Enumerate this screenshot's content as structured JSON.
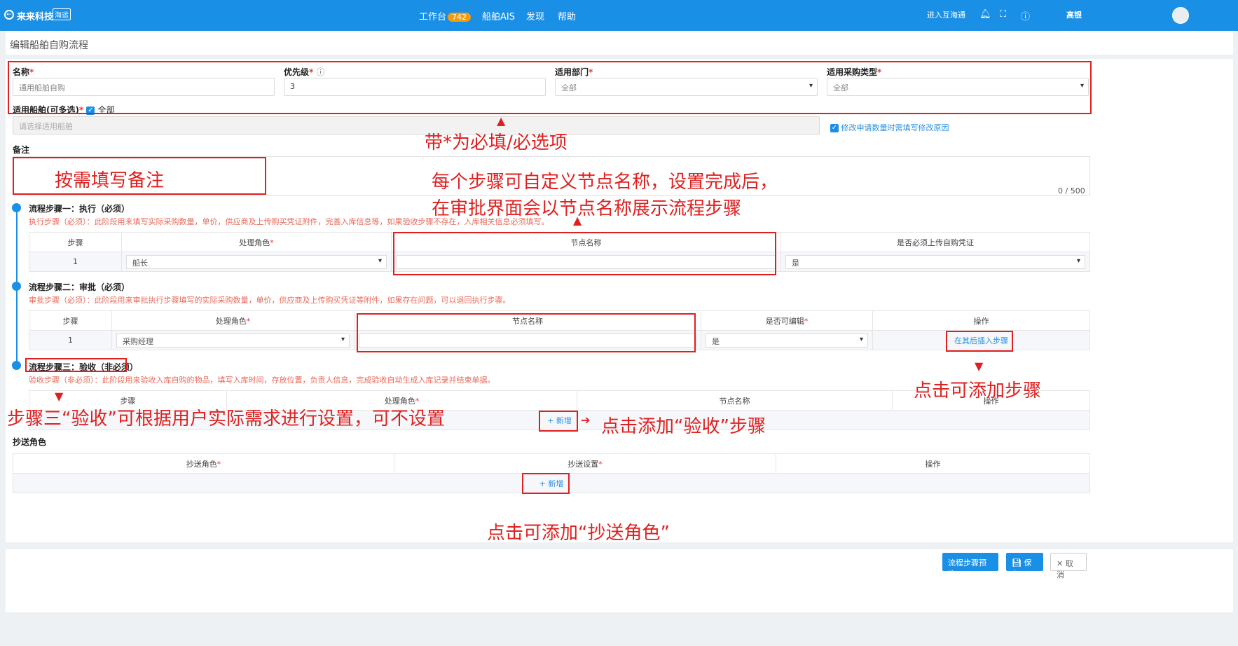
{
  "topbar": {
    "logo": "来来科技",
    "logo_sub": "海运",
    "nav": [
      {
        "label": "工作台",
        "badge": "742"
      },
      {
        "label": "船舶AIS"
      },
      {
        "label": "发现"
      },
      {
        "label": "帮助"
      }
    ],
    "enter_label": "进入互海通",
    "user_name": "高银",
    "colors": {
      "bar": "#1a8fe6",
      "badge": "#f39c12"
    }
  },
  "page": {
    "title": "编辑船舶自购流程"
  },
  "form": {
    "name": {
      "label": "名称",
      "placeholder": "通用船舶自购"
    },
    "priority": {
      "label": "优先级",
      "value": "3"
    },
    "dept": {
      "label": "适用部门",
      "value": "全部"
    },
    "ptype": {
      "label": "适用采购类型",
      "value": "全部"
    },
    "ships": {
      "label": "适用船舶(可多选)",
      "all_label": "全部",
      "placeholder": "请选择适用船舶"
    },
    "hint": "修改申请数量时需填写修改原因",
    "remark": {
      "label": "备注",
      "counter": "0 / 500"
    }
  },
  "step1": {
    "title": "流程步骤一：执行（必须）",
    "desc": "执行步骤（必须）：此阶段用来填写实际采购数量，单价，供应商及上传购买凭证附件，完善入库信息等，如果验收步骤不存在，入库相关信息必须填写。",
    "headers": [
      "步骤",
      "处理角色",
      "节点名称",
      "是否必须上传自购凭证"
    ],
    "row": {
      "step": "1",
      "role": "船长",
      "upload": "是"
    }
  },
  "step2": {
    "title": "流程步骤二：审批（必须）",
    "desc": "审批步骤（必须）：此阶段用来审批执行步骤填写的实际采购数量，单价，供应商及上传购买凭证等附件，如果存在问题，可以退回执行步骤。",
    "headers": [
      "步骤",
      "处理角色",
      "节点名称",
      "是否可编辑",
      "操作"
    ],
    "row": {
      "step": "1",
      "role": "采购经理",
      "editable": "是",
      "action": "在其后插入步骤"
    }
  },
  "step3": {
    "title": "流程步骤三：验收（非必须）",
    "desc": "验收步骤（非必须）：此阶段用来验收入库自购的物品，填写入库时间，存放位置，负责人信息，完成验收自动生成入库记录并结束单据。",
    "headers": [
      "步骤",
      "处理角色",
      "节点名称",
      "操作"
    ],
    "add_label": "+ 新增"
  },
  "cc": {
    "title": "抄送角色",
    "headers": [
      "抄送角色",
      "抄送设置",
      "操作"
    ],
    "add_label": "+ 新增"
  },
  "annotations": {
    "required": "带*为必填/必选项",
    "remark": "按需填写备注",
    "node_line1": "每个步骤可自定义节点名称，设置完成后，",
    "node_line2": "在审批界面会以节点名称展示流程步骤",
    "step3": "步骤三“验收”可根据用户实际需求进行设置，可不设置",
    "add_step": "点击可添加步骤",
    "add_accept": "点击添加“验收”步骤",
    "add_cc": "点击可添加“抄送角色”"
  },
  "footer": {
    "preview": "流程步骤预览",
    "save": "保存",
    "cancel": "取消"
  }
}
